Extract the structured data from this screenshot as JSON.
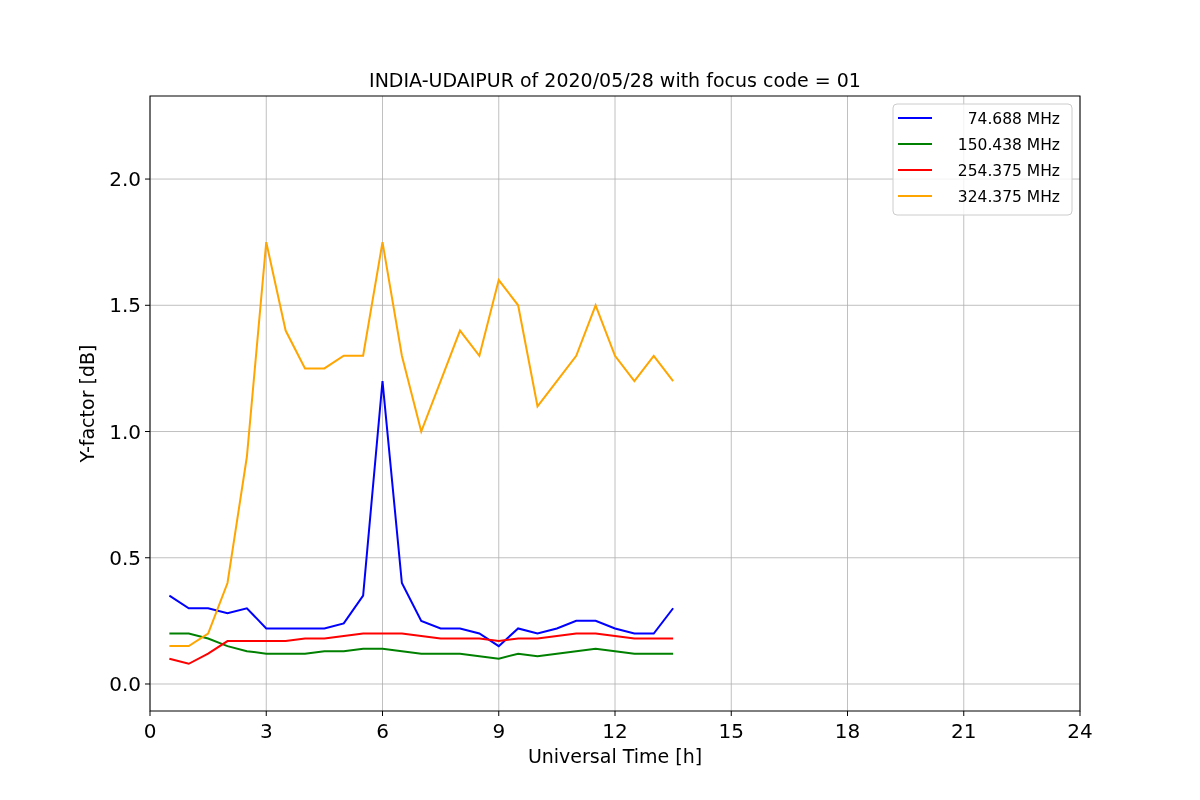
{
  "chart_data": {
    "type": "line",
    "title": "INDIA-UDAIPUR of 2020/05/28 with focus code = 01",
    "xlabel": "Universal Time [h]",
    "ylabel": "Y-factor [dB]",
    "x": [
      0.5,
      1,
      1.5,
      2,
      2.5,
      3,
      3.5,
      4,
      4.5,
      5,
      5.5,
      6,
      6.5,
      7,
      7.5,
      8,
      8.5,
      9,
      9.5,
      10,
      10.5,
      11,
      11.5,
      12,
      12.5,
      13,
      13.5
    ],
    "series": [
      {
        "name": "74.688 MHz",
        "color": "#0000ff",
        "values": [
          0.35,
          0.3,
          0.3,
          0.28,
          0.3,
          0.22,
          0.22,
          0.22,
          0.22,
          0.24,
          0.35,
          1.2,
          0.4,
          0.25,
          0.22,
          0.22,
          0.2,
          0.15,
          0.22,
          0.2,
          0.22,
          0.25,
          0.25,
          0.22,
          0.2,
          0.2,
          0.3
        ]
      },
      {
        "name": "150.438 MHz",
        "color": "#008000",
        "values": [
          0.2,
          0.2,
          0.18,
          0.15,
          0.13,
          0.12,
          0.12,
          0.12,
          0.13,
          0.13,
          0.14,
          0.14,
          0.13,
          0.12,
          0.12,
          0.12,
          0.11,
          0.1,
          0.12,
          0.11,
          0.12,
          0.13,
          0.14,
          0.13,
          0.12,
          0.12,
          0.12
        ]
      },
      {
        "name": "254.375 MHz",
        "color": "#ff0000",
        "values": [
          0.1,
          0.08,
          0.12,
          0.17,
          0.17,
          0.17,
          0.17,
          0.18,
          0.18,
          0.19,
          0.2,
          0.2,
          0.2,
          0.19,
          0.18,
          0.18,
          0.18,
          0.17,
          0.18,
          0.18,
          0.19,
          0.2,
          0.2,
          0.19,
          0.18,
          0.18,
          0.18
        ]
      },
      {
        "name": "324.375 MHz",
        "color": "#ffa500",
        "values": [
          0.15,
          0.15,
          0.2,
          0.4,
          0.9,
          1.75,
          1.4,
          1.25,
          1.25,
          1.3,
          1.3,
          1.75,
          1.3,
          1.0,
          1.2,
          1.4,
          1.3,
          1.6,
          1.5,
          1.1,
          1.2,
          1.3,
          1.5,
          1.3,
          1.2,
          1.3,
          1.2
        ]
      }
    ],
    "xlim": [
      0,
      24
    ],
    "ylim": [
      -0.107,
      2.329
    ],
    "xticks": [
      0,
      3,
      6,
      9,
      12,
      15,
      18,
      21,
      24
    ],
    "grid": true,
    "legend": true,
    "yticks": [
      {
        "value": 0,
        "label": "0.0"
      },
      {
        "value": 0.5,
        "label": "0.5"
      },
      {
        "value": 1,
        "label": "1.0"
      },
      {
        "value": 1.5,
        "label": "1.5"
      },
      {
        "value": 2,
        "label": "2.0"
      }
    ]
  }
}
